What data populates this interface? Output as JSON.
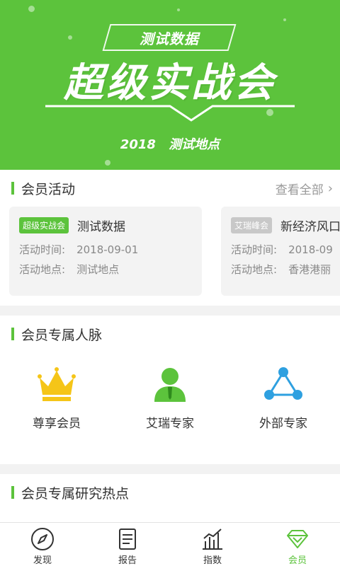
{
  "hero": {
    "tag": "测试数据",
    "title": "超级实战会",
    "year": "2018",
    "location": "测试地点"
  },
  "activities": {
    "title": "会员活动",
    "more": "查看全部",
    "cards": [
      {
        "badge": "超级实战会",
        "name": "测试数据",
        "time_label": "活动时间:",
        "time": "2018-09-01",
        "place_label": "活动地点:",
        "place": "测试地点"
      },
      {
        "badge": "艾瑞峰会",
        "name": "新经济风口",
        "time_label": "活动时间:",
        "time": "2018-09",
        "place_label": "活动地点:",
        "place": "香港港丽"
      }
    ]
  },
  "network": {
    "title": "会员专属人脉",
    "items": [
      {
        "label": "尊享会员",
        "icon": "crown-icon"
      },
      {
        "label": "艾瑞专家",
        "icon": "expert-person-icon"
      },
      {
        "label": "外部专家",
        "icon": "share-network-icon"
      }
    ]
  },
  "research": {
    "title": "会员专属研究热点"
  },
  "tabs": [
    {
      "label": "发现",
      "icon": "compass-icon",
      "active": false
    },
    {
      "label": "报告",
      "icon": "report-icon",
      "active": false
    },
    {
      "label": "指数",
      "icon": "chart-icon",
      "active": false
    },
    {
      "label": "会员",
      "icon": "diamond-icon",
      "active": true
    }
  ],
  "colors": {
    "accent": "#5cc33c",
    "badge_gray": "#c8c8c8"
  }
}
